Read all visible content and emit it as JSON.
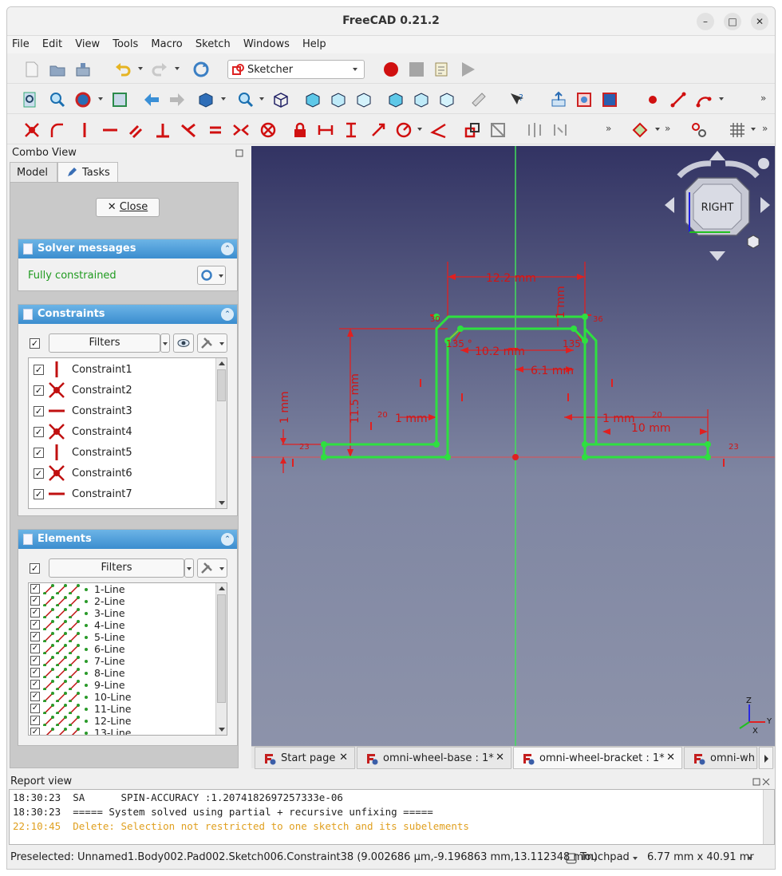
{
  "window": {
    "title": "FreeCAD 0.21.2"
  },
  "menu": [
    "File",
    "Edit",
    "View",
    "Tools",
    "Macro",
    "Sketch",
    "Windows",
    "Help"
  ],
  "toolbar": {
    "workbench": "Sketcher",
    "overflow": "»"
  },
  "combo_view": {
    "title": "Combo View",
    "tabs": [
      "Model",
      "Tasks"
    ],
    "close_label": "Close",
    "solver": {
      "title": "Solver messages",
      "status": "Fully constrained",
      "status_color": "#1f9a1f"
    },
    "constraints": {
      "title": "Constraints",
      "filters_label": "Filters",
      "items": [
        {
          "label": "Constraint1",
          "icon": "vertical-constraint-icon"
        },
        {
          "label": "Constraint2",
          "icon": "coincident-constraint-icon"
        },
        {
          "label": "Constraint3",
          "icon": "horizontal-constraint-icon"
        },
        {
          "label": "Constraint4",
          "icon": "coincident-constraint-icon"
        },
        {
          "label": "Constraint5",
          "icon": "vertical-constraint-icon"
        },
        {
          "label": "Constraint6",
          "icon": "coincident-constraint-icon"
        },
        {
          "label": "Constraint7",
          "icon": "horizontal-constraint-icon"
        }
      ]
    },
    "elements": {
      "title": "Elements",
      "filters_label": "Filters",
      "items": [
        "1-Line",
        "2-Line",
        "3-Line",
        "4-Line",
        "5-Line",
        "6-Line",
        "7-Line",
        "8-Line",
        "9-Line",
        "10-Line",
        "11-Line",
        "12-Line",
        "13-Line"
      ]
    }
  },
  "viewport": {
    "navcube_face": "RIGHT",
    "axes": {
      "z": "Z",
      "x": "X",
      "y": "Y"
    },
    "dims": {
      "d1": "12.2 mm",
      "d2": "1 mm",
      "d3": "10.2 mm",
      "d4": "6.1 mm",
      "d5": "11.5 mm",
      "d6": "1 mm",
      "d7": "1 mm",
      "d8": "1 mm",
      "d9": "10 mm",
      "d10": "135",
      "d11": "135 °"
    },
    "tags": {
      "t20a": "20",
      "t20b": "20",
      "t23a": "23",
      "t23b": "23",
      "t30": "30",
      "t36": "36"
    }
  },
  "document_tabs": [
    "Start page",
    "omni-wheel-base : 1*",
    "omni-wheel-bracket : 1*",
    "omni-wh"
  ],
  "report": {
    "title": "Report view",
    "lines": [
      {
        "text": "18:30:23  SA      SPIN-ACCURACY :1.2074182697257333e-06",
        "color": "#222222"
      },
      {
        "text": "18:30:23  ===== System solved using partial + recursive unfixing =====",
        "color": "#222222"
      },
      {
        "text": "22:10:45  Delete: Selection not restricted to one sketch and its subelements",
        "color": "#e0a020"
      }
    ]
  },
  "status": {
    "preselected": "Preselected: Unnamed1.Body002.Pad002.Sketch006.Constraint38 (9.002686 µm,-9.196863 mm,13.112348 mm)",
    "navigation": "Touchpad",
    "dimensions": "6.77 mm x 40.91 mr"
  }
}
